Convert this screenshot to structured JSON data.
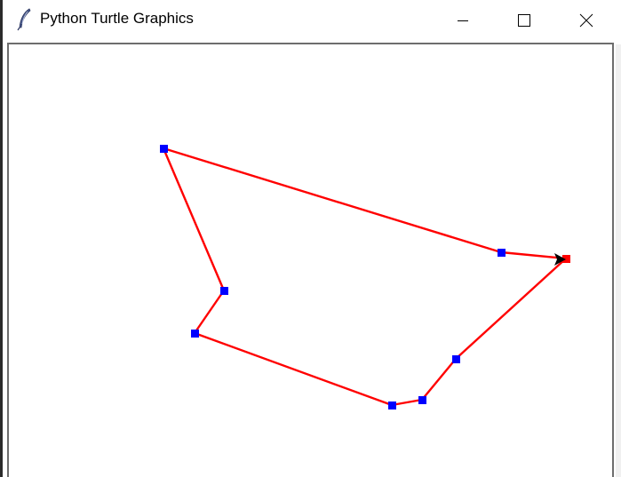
{
  "window": {
    "title": "Python Turtle Graphics",
    "app_icon": "feather-icon",
    "controls": {
      "minimize_icon": "minimize-icon",
      "maximize_icon": "maximize-icon",
      "close_icon": "close-icon"
    }
  },
  "canvas": {
    "background": "#ffffff",
    "line_color": "#ff0000",
    "vertex_color": "#0000ff",
    "end_dot_color": "#ff0000",
    "turtle_color": "#000000",
    "turtle_icon": "turtle-arrow-icon"
  }
}
